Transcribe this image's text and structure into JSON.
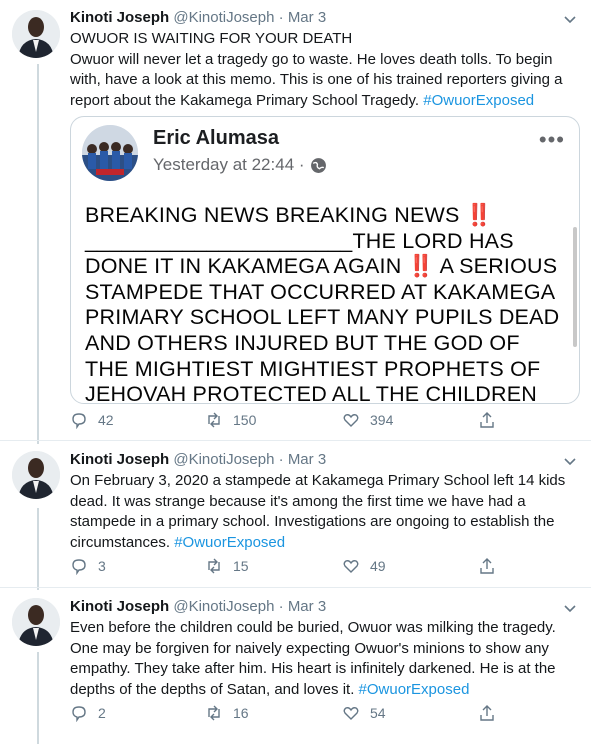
{
  "colors": {
    "link": "#1b95e0",
    "muted": "#657786",
    "divider": "#e6ecf0"
  },
  "tweets": [
    {
      "author_name": "Kinoti Joseph",
      "author_handle": "@KinotiJoseph",
      "separator": "·",
      "date": "Mar 3",
      "text_line1": "OWUOR IS WAITING FOR YOUR DEATH",
      "text_line2": "Owuor will never let a tragedy go to waste. He loves death tolls. To begin with, have a look at this memo. This is one of his trained reporters giving a report about the Kakamega Primary School Tragedy. ",
      "hashtag": "#OwuorExposed",
      "replies": "42",
      "retweets": "150",
      "likes": "394",
      "card": {
        "name": "Eric Alumasa",
        "time": "Yesterday at 22:44 ·",
        "more": "•••",
        "text_a": "BREAKING NEWS BREAKING NEWS ",
        "bang1": "‼️",
        "text_b": " ______________________THE LORD HAS DONE IT IN KAKAMEGA AGAIN ",
        "bang2": "‼️",
        "text_c": " A SERIOUS STAMPEDE THAT OCCURRED AT KAKAMEGA PRIMARY SCHOOL LEFT MANY PUPILS DEAD AND OTHERS INJURED BUT  THE GOD OF THE MIGHTIEST MIGHTIEST PROPHETS OF JEHOVAH PROTECTED ALL THE CHILDREN FROM KAKAMEGA PRIMARY"
      }
    },
    {
      "author_name": "Kinoti Joseph",
      "author_handle": "@KinotiJoseph",
      "separator": "·",
      "date": "Mar 3",
      "text": "On February 3, 2020 a stampede at Kakamega Primary School left 14 kids dead. It was strange because it's among the first time we have had a stampede in a primary school. Investigations are ongoing to establish the circumstances. ",
      "hashtag": "#OwuorExposed",
      "replies": "3",
      "retweets": "15",
      "likes": "49"
    },
    {
      "author_name": "Kinoti Joseph",
      "author_handle": "@KinotiJoseph",
      "separator": "·",
      "date": "Mar 3",
      "text": "Even before the children could be buried, Owuor was milking the tragedy. One may be forgiven for naively expecting Owuor's minions to show any empathy. They take after him. His heart is infinitely darkened. He is at the depths of the depths of Satan, and loves it. ",
      "hashtag": "#OwuorExposed",
      "replies": "2",
      "retweets": "16",
      "likes": "54"
    }
  ]
}
